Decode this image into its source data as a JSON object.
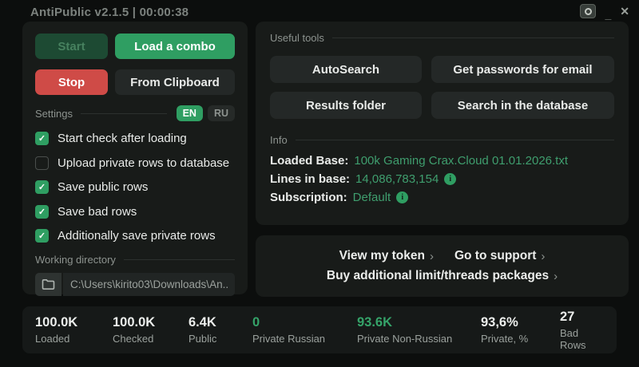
{
  "colors": {
    "accent_green": "#2f9e62",
    "accent_red": "#cf4b47",
    "green_text": "#3f9e6e",
    "panel_bg": "#181b19",
    "window_bg": "#0c0e0d"
  },
  "window": {
    "title": "AntiPublic v2.1.5 | 00:00:38",
    "controls": {
      "circle": "○",
      "minimize": "_",
      "close": "✕"
    }
  },
  "left_panel": {
    "buttons": {
      "start": "Start",
      "load_combo": "Load a combo",
      "stop": "Stop",
      "from_clipboard": "From Clipboard"
    },
    "settings": {
      "label": "Settings",
      "languages": [
        {
          "code": "EN",
          "active": true
        },
        {
          "code": "RU",
          "active": false
        }
      ],
      "checkboxes": [
        {
          "label": "Start check after loading",
          "checked": true
        },
        {
          "label": "Upload private rows to database",
          "checked": false
        },
        {
          "label": "Save public rows",
          "checked": true
        },
        {
          "label": "Save bad rows",
          "checked": true
        },
        {
          "label": "Additionally save private rows",
          "checked": true
        }
      ],
      "check_glyph": "✓"
    },
    "working_directory": {
      "label": "Working directory",
      "path": "C:\\Users\\kirito03\\Downloads\\An..."
    }
  },
  "tools_panel": {
    "useful_tools": {
      "label": "Useful tools",
      "buttons": [
        "AutoSearch",
        "Get passwords for email",
        "Results folder",
        "Search in the database"
      ]
    },
    "info": {
      "label": "Info",
      "rows": [
        {
          "key": "Loaded Base:",
          "value": "100k Gaming Crax.Cloud 01.01.2026.txt",
          "has_info_icon": false
        },
        {
          "key": "Lines in base:",
          "value": "14,086,783,154",
          "has_info_icon": true
        },
        {
          "key": "Subscription:",
          "value": "Default",
          "has_info_icon": true
        }
      ],
      "info_icon_glyph": "i"
    }
  },
  "links_panel": {
    "chevron": "›",
    "links": [
      {
        "label": "View my token"
      },
      {
        "label": "Go to support"
      },
      {
        "label": "Buy additional limit/threads packages"
      }
    ]
  },
  "stats": [
    {
      "value": "100.0K",
      "label": "Loaded",
      "green": false
    },
    {
      "value": "100.0K",
      "label": "Checked",
      "green": false
    },
    {
      "value": "6.4K",
      "label": "Public",
      "green": false
    },
    {
      "value": "0",
      "label": "Private Russian",
      "green": true
    },
    {
      "value": "93.6K",
      "label": "Private Non-Russian",
      "green": true
    },
    {
      "value": "93,6%",
      "label": "Private, %",
      "green": false
    },
    {
      "value": "27",
      "label": "Bad Rows",
      "green": false
    }
  ]
}
